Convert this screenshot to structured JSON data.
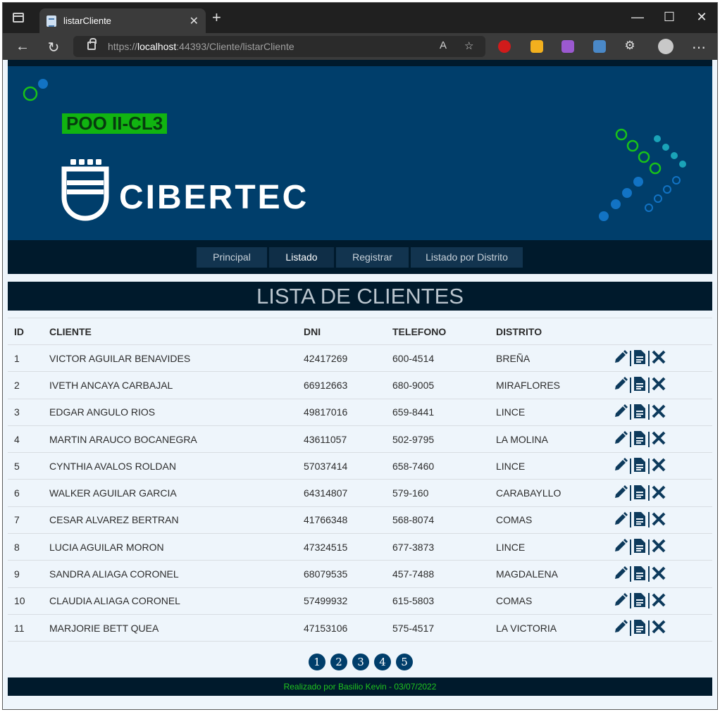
{
  "browser": {
    "tab_title": "listarCliente",
    "url_scheme": "https://",
    "url_host": "localhost",
    "url_rest": ":44393/Cliente/listarCliente"
  },
  "banner": {
    "course": "POO II-CL3",
    "brand": "CIBERTEC"
  },
  "menu": [
    "Principal",
    "Listado",
    "Registrar",
    "Listado por Distrito"
  ],
  "page_title": "LISTA DE CLIENTES",
  "table": {
    "headers": [
      "ID",
      "CLIENTE",
      "DNI",
      "TELEFONO",
      "DISTRITO"
    ],
    "rows": [
      [
        "1",
        "VICTOR AGUILAR BENAVIDES",
        "42417269",
        "600-4514",
        "BREÑA"
      ],
      [
        "2",
        "IVETH ANCAYA CARBAJAL",
        "66912663",
        "680-9005",
        "MIRAFLORES"
      ],
      [
        "3",
        "EDGAR ANGULO RIOS",
        "49817016",
        "659-8441",
        "LINCE"
      ],
      [
        "4",
        "MARTIN ARAUCO BOCANEGRA",
        "43611057",
        "502-9795",
        "LA MOLINA"
      ],
      [
        "5",
        "CYNTHIA AVALOS ROLDAN",
        "57037414",
        "658-7460",
        "LINCE"
      ],
      [
        "6",
        "WALKER AGUILAR GARCIA",
        "64314807",
        "579-160",
        "CARABAYLLO"
      ],
      [
        "7",
        "CESAR ALVAREZ BERTRAN",
        "41766348",
        "568-8074",
        "COMAS"
      ],
      [
        "8",
        "LUCIA AGUILAR MORON",
        "47324515",
        "677-3873",
        "LINCE"
      ],
      [
        "9",
        "SANDRA ALIAGA CORONEL",
        "68079535",
        "457-7488",
        "MAGDALENA"
      ],
      [
        "10",
        "CLAUDIA ALIAGA CORONEL",
        "57499932",
        "615-5803",
        "COMAS"
      ],
      [
        "11",
        "MARJORIE BETT QUEA",
        "47153106",
        "575-4517",
        "LA VICTORIA"
      ]
    ]
  },
  "pagination": [
    "1",
    "2",
    "3",
    "4",
    "5"
  ],
  "footer": "Realizado por Basilio Kevin - 03/07/2022",
  "colors": {
    "banner": "#003e6b",
    "dark": "#001a2c",
    "accent_green": "#11b411",
    "page_bg": "#eef5fb"
  }
}
